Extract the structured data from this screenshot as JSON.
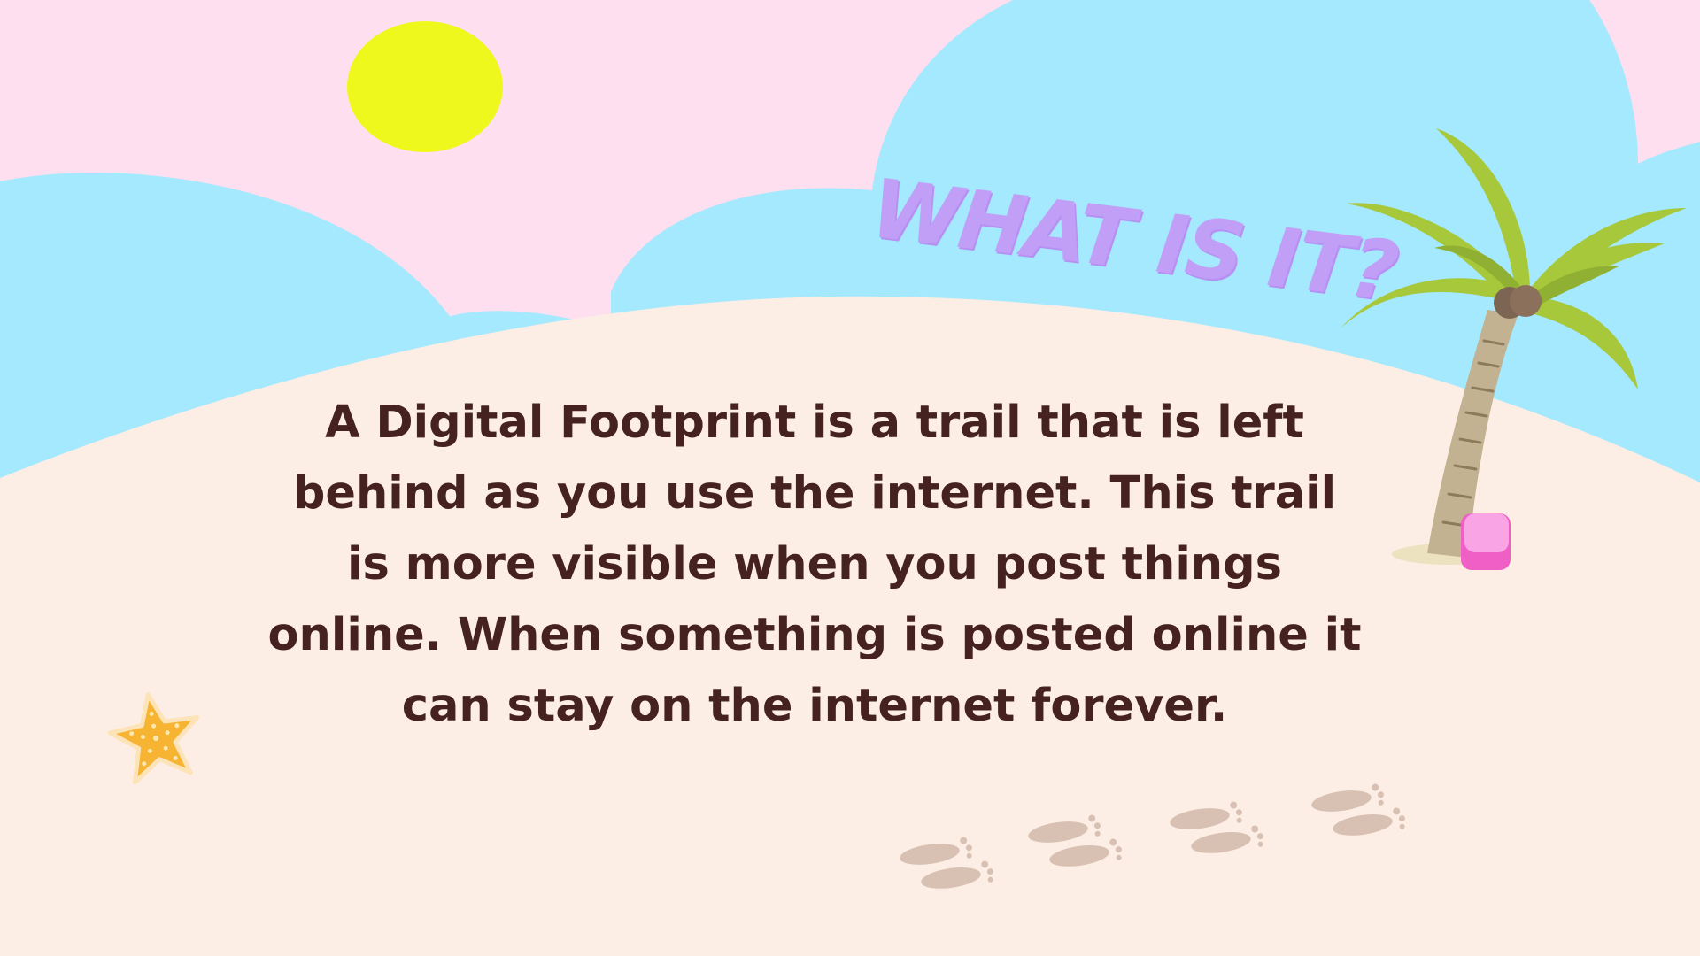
{
  "slide": {
    "title": "WHAT IS IT?",
    "body": "A Digital Footprint is a trail that is left behind as you use the internet. This trail is more visible when you post things online. When something is posted online it can stay on the internet forever."
  },
  "illustrations": {
    "sun": "sun-icon",
    "palm_tree": "palm-tree-icon",
    "starfish": "starfish-icon",
    "bucket": "bucket-icon",
    "footprints": "footprints-icon"
  },
  "colors": {
    "sky": "#fddff0",
    "hills": "#a4e9fd",
    "sand": "#fdeee5",
    "sun": "#eff81c",
    "title": "#c19ff7",
    "body_text": "#45221f",
    "footprint": "#d8c1b3",
    "palm_leaf": "#a8c83c",
    "palm_trunk": "#c2b291",
    "starfish": "#f6b432",
    "bucket": "#f77fd6"
  }
}
